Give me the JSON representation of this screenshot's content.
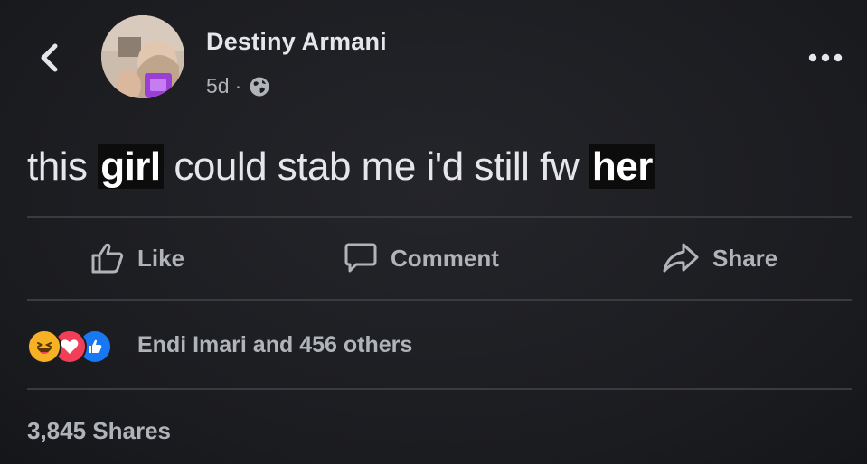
{
  "post": {
    "author": "Destiny Armani",
    "time": "5d",
    "separator": "·",
    "privacy_icon": "globe-icon",
    "text_parts": [
      "this ",
      "girl",
      " could stab me i'd still fw ",
      "her"
    ]
  },
  "actions": {
    "like_label": "Like",
    "comment_label": "Comment",
    "share_label": "Share"
  },
  "reactions": {
    "icons": [
      "haha-icon",
      "love-icon",
      "like-icon"
    ],
    "summary": "Endi Imari and 456 others"
  },
  "shares": {
    "label": "3,845 Shares"
  },
  "colors": {
    "background": "#1c1d21",
    "text_primary": "#e4e6eb",
    "text_secondary": "#b0b3b8",
    "divider": "#3a3b3f",
    "like_blue": "#1877f2",
    "love_red": "#f33e58",
    "haha_yellow": "#f7b125"
  }
}
